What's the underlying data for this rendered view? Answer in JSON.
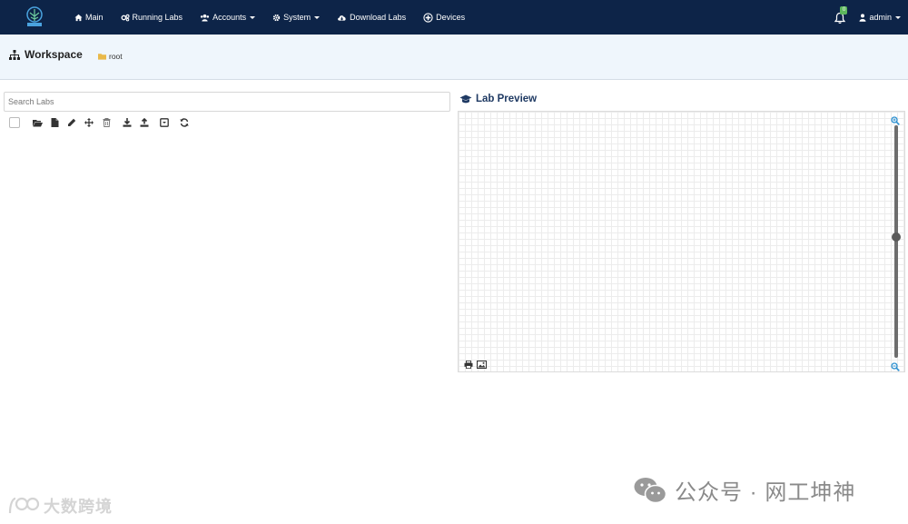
{
  "navbar": {
    "items": [
      {
        "label": "Main",
        "icon": "home-icon",
        "dropdown": false
      },
      {
        "label": "Running Labs",
        "icon": "cogs-icon",
        "dropdown": false
      },
      {
        "label": "Accounts",
        "icon": "users-icon",
        "dropdown": true
      },
      {
        "label": "System",
        "icon": "cog-icon",
        "dropdown": true
      },
      {
        "label": "Download Labs",
        "icon": "cloud-download-icon",
        "dropdown": false
      },
      {
        "label": "Devices",
        "icon": "plus-circle-icon",
        "dropdown": false
      }
    ],
    "notification_count": "0",
    "user_label": "admin",
    "colors": {
      "background": "#0d2448",
      "text": "#ffffff",
      "badge": "#5cb85c"
    }
  },
  "workspace": {
    "title": "Workspace",
    "breadcrumb": "root"
  },
  "left_pane": {
    "search_placeholder": "Search Labs",
    "toolbar_icons": [
      "select-all-checkbox",
      "open-folder-icon",
      "new-file-icon",
      "edit-icon",
      "move-icon",
      "delete-icon",
      "download-icon",
      "upload-icon",
      "export-icon",
      "refresh-icon"
    ]
  },
  "preview": {
    "title": "Lab Preview",
    "icons": [
      "zoom-in-icon",
      "zoom-out-icon",
      "print-icon",
      "image-icon"
    ],
    "zoom_level_fraction": 0.52
  },
  "watermarks": {
    "left": "大数跨境",
    "right": "公众号 · 网工坤神"
  }
}
